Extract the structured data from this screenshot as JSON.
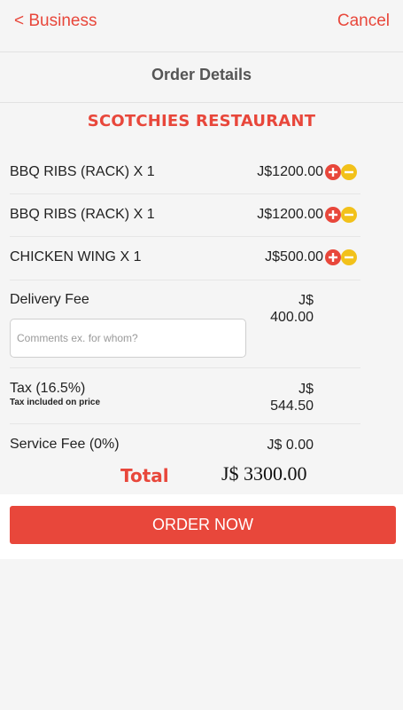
{
  "nav": {
    "back_label": "< Business",
    "cancel_label": "Cancel"
  },
  "header": {
    "title": "Order Details"
  },
  "restaurant": {
    "name": "SCOTCHIES RESTAURANT"
  },
  "items": [
    {
      "name": "BBQ RIBS (RACK) X 1",
      "price": "J$1200.00"
    },
    {
      "name": "BBQ RIBS (RACK) X 1",
      "price": "J$1200.00"
    },
    {
      "name": "CHICKEN WING X 1",
      "price": "J$500.00"
    }
  ],
  "delivery": {
    "label": "Delivery Fee",
    "currency": "J$",
    "amount": "400.00"
  },
  "comments": {
    "placeholder": "Comments ex. for whom?",
    "value": ""
  },
  "tax": {
    "label": "Tax (16.5%)",
    "note": "Tax included on price",
    "currency": "J$",
    "amount": "544.50"
  },
  "service": {
    "label": "Service Fee (0%)",
    "value": "J$ 0.00"
  },
  "total": {
    "label": "Total",
    "value": "J$ 3300.00"
  },
  "order_button": {
    "label": "ORDER NOW"
  },
  "colors": {
    "accent": "#e8473b",
    "minus": "#f2c11a",
    "background": "#f5f5f5"
  },
  "icons": {
    "add": "plus-circle-icon",
    "remove": "minus-circle-icon"
  }
}
